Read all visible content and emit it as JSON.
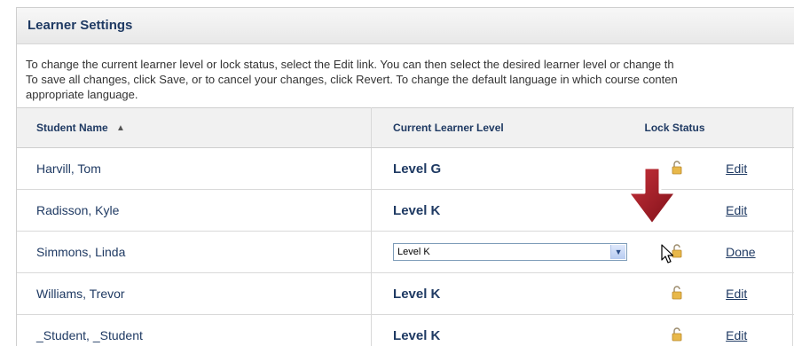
{
  "panel": {
    "title": "Learner Settings",
    "instructions": [
      "To change the current learner level or lock status, select the Edit link. You can then select the desired learner level or change th",
      "To save all changes, click Save, or to cancel your changes, click Revert. To change the default language in which course conten",
      "appropriate language."
    ]
  },
  "table": {
    "headers": {
      "student_name": "Student Name",
      "current_level": "Current Learner Level",
      "lock_status": "Lock Status"
    },
    "rows": [
      {
        "name": "Harvill, Tom",
        "level": "Level G",
        "action": "Edit"
      },
      {
        "name": "Radisson, Kyle",
        "level": "Level K",
        "action": "Edit"
      },
      {
        "name": "Simmons, Linda",
        "level": "Level K",
        "action": "Done"
      },
      {
        "name": "Williams, Trevor",
        "level": "Level K",
        "action": "Edit"
      },
      {
        "name": "_Student, _Student",
        "level": "Level K",
        "action": "Edit"
      }
    ]
  },
  "icons": {
    "sort": "sort-ascending-icon",
    "lock": "unlocked-padlock-icon",
    "annotation": "red-down-arrow-icon",
    "cursor": "mouse-pointer-icon"
  },
  "colors": {
    "text": "#1f3a63",
    "annotation_arrow": "#a01822",
    "padlock": "#e8b84a"
  }
}
